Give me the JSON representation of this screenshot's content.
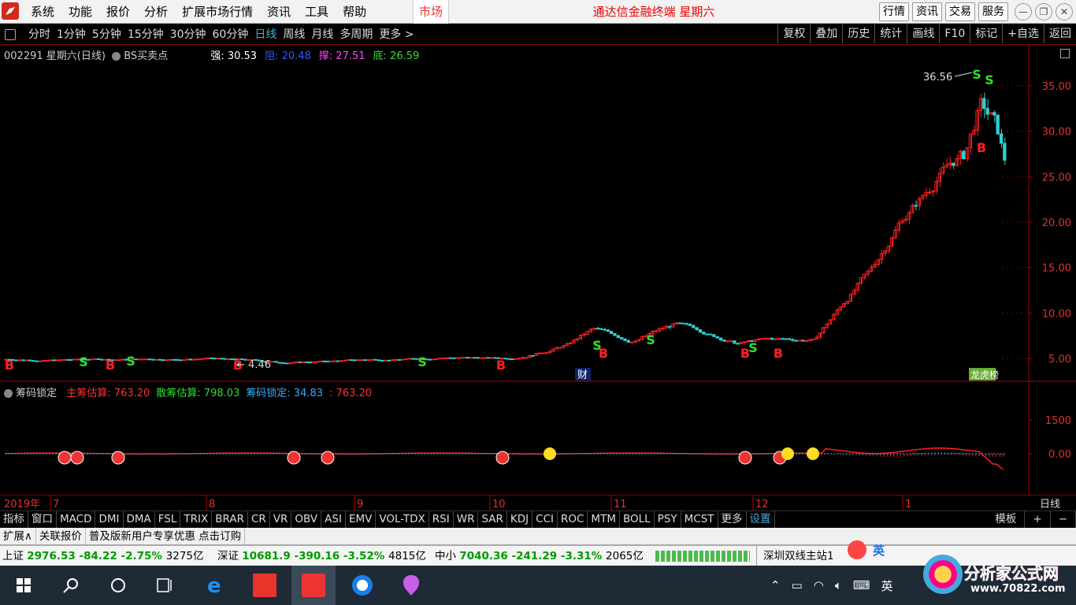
{
  "menubar": {
    "menus": [
      "系统",
      "功能",
      "报价",
      "分析",
      "扩展市场行情",
      "资讯",
      "工具",
      "帮助"
    ],
    "market": "市场",
    "title": "通达信金融终端  星期六",
    "right_buttons": [
      "行情",
      "资讯",
      "交易",
      "服务"
    ]
  },
  "periodbar": {
    "periods": [
      "分时",
      "1分钟",
      "5分钟",
      "15分钟",
      "30分钟",
      "60分钟",
      "日线",
      "周线",
      "月线",
      "多周期",
      "更多 >"
    ],
    "active": "日线",
    "tools": [
      "复权",
      "叠加",
      "历史",
      "统计",
      "画线",
      "F10",
      "标记",
      "+自选",
      "返回"
    ]
  },
  "main": {
    "code": "002291",
    "name": "星期六",
    "period_label": "(日线)",
    "indicator": "BS买卖点",
    "stats": [
      {
        "label": "强:",
        "value": "30.53",
        "color": "#ffffff"
      },
      {
        "label": "阻:",
        "value": "20.48",
        "color": "#3355ff"
      },
      {
        "label": "撑:",
        "value": "27.51",
        "color": "#ff44ff"
      },
      {
        "label": "底:",
        "value": "26.59",
        "color": "#33dd33"
      }
    ],
    "y_ticks": [
      "35.00",
      "30.00",
      "25.00",
      "20.00",
      "15.00",
      "10.00",
      "5.00"
    ],
    "high_label": "36.56",
    "low_label": "4.46",
    "tag_cai": "财",
    "tag_rank": "龙虎榜",
    "b_mark": "B",
    "s_mark": "S"
  },
  "sub": {
    "name": "筹码锁定",
    "items": [
      {
        "label": "主筹估算:",
        "value": "763.20",
        "color": "#ff3030"
      },
      {
        "label": "散筹估算:",
        "value": "798.03",
        "color": "#30dd30"
      },
      {
        "label": "筹码锁定:",
        "value": "34.83",
        "color": "#33aaff"
      },
      {
        "label": ":",
        "value": "763.20",
        "color": "#ff3030"
      }
    ],
    "y_ticks": [
      "1500",
      "0.00"
    ]
  },
  "dateaxis": {
    "year": "2019年",
    "months": [
      "7",
      "8",
      "9",
      "10",
      "11",
      "12",
      "1"
    ],
    "right_label": "日线"
  },
  "indbar": {
    "items": [
      "指标",
      "窗口",
      "MACD",
      "DMI",
      "DMA",
      "FSL",
      "TRIX",
      "BRAR",
      "CR",
      "VR",
      "OBV",
      "ASI",
      "EMV",
      "VOL-TDX",
      "RSI",
      "WR",
      "SAR",
      "KDJ",
      "CCI",
      "ROC",
      "MTM",
      "BOLL",
      "PSY",
      "MCST",
      "更多",
      "设置"
    ],
    "right": [
      "模板",
      "+",
      "−"
    ]
  },
  "extbar": {
    "items": [
      "扩展∧",
      "关联报价",
      "普及版新用户专享优惠  点击订购"
    ]
  },
  "status": {
    "indices": [
      {
        "name": "上证",
        "price": "2976.53",
        "chg": "-84.22",
        "pct": "-2.75%",
        "amount": "3275亿"
      },
      {
        "name": "深证",
        "price": "10681.9",
        "chg": "-390.16",
        "pct": "-3.52%",
        "amount": "4815亿"
      },
      {
        "name": "中小",
        "price": "7040.36",
        "chg": "-241.29",
        "pct": "-3.31%",
        "amount": "2065亿"
      }
    ],
    "server": "深圳双线主站1",
    "ime": "英"
  },
  "taskbar": {
    "tray_lang": "英"
  },
  "watermark": {
    "title": "分析家公式网",
    "url": "www.70822.com"
  }
}
